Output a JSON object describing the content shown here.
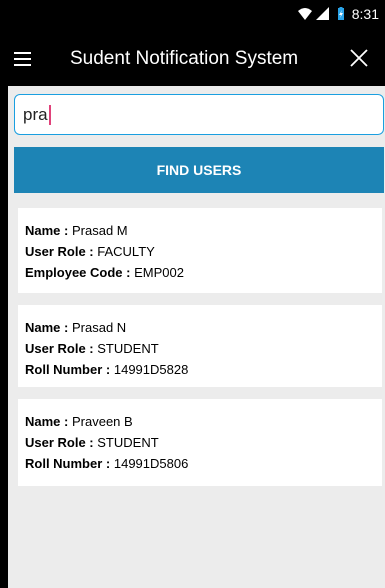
{
  "status_bar": {
    "time": "8:31",
    "icons": [
      "wifi-icon",
      "signal-icon",
      "battery-icon"
    ]
  },
  "toolbar": {
    "title": "Sudent Notification System",
    "menu_icon": "menu-icon",
    "close_icon": "close-icon"
  },
  "search": {
    "value": "pra"
  },
  "find_button": {
    "label": "FIND USERS"
  },
  "users": [
    {
      "name_label": "Name :",
      "name": "Prasad M",
      "role_label": "User Role :",
      "role": "FACULTY",
      "code_label": "Employee Code :",
      "code": "EMP002"
    },
    {
      "name_label": "Name :",
      "name": "Prasad N",
      "role_label": "User Role :",
      "role": "STUDENT",
      "code_label": "Roll Number :",
      "code": "14991D5828"
    },
    {
      "name_label": "Name :",
      "name": "Praveen B",
      "role_label": "User Role :",
      "role": "STUDENT",
      "code_label": "Roll Number :",
      "code": "14991D5806"
    }
  ],
  "colors": {
    "accent": "#1d84b5",
    "field_border": "#1a9fe0",
    "caret": "#e0427a",
    "background": "#ececec"
  }
}
